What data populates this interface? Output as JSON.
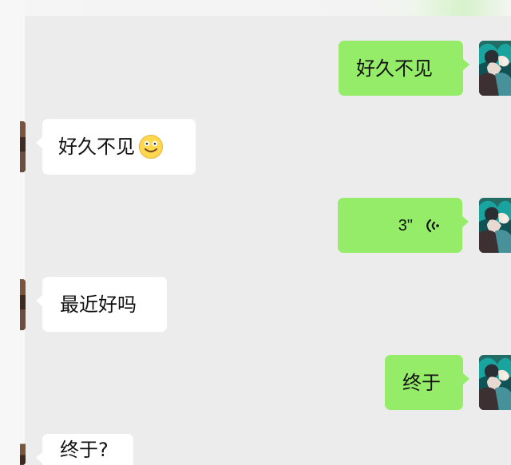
{
  "chat": {
    "messages": [
      {
        "id": "m1",
        "side": "sent",
        "text": "好久不见"
      },
      {
        "id": "m2",
        "side": "received",
        "text": "好久不见",
        "emoji": "smile-emoji"
      },
      {
        "id": "m3",
        "side": "sent",
        "voice_duration": "3\""
      },
      {
        "id": "m4",
        "side": "received",
        "text": "最近好吗"
      },
      {
        "id": "m5",
        "side": "sent",
        "text": "终于"
      },
      {
        "id": "m6",
        "side": "received",
        "text": "终于?"
      }
    ]
  },
  "icons": {
    "voice": "voice-wave-icon",
    "emoji": "smile-emoji-icon",
    "self_avatar": "avatar",
    "partner_avatar": "avatar"
  },
  "colors": {
    "chat_background": "#ececec",
    "sent_bubble": "#95ec69",
    "received_bubble": "#ffffff",
    "text": "#111111",
    "side_strip": "#f7f7f7"
  }
}
